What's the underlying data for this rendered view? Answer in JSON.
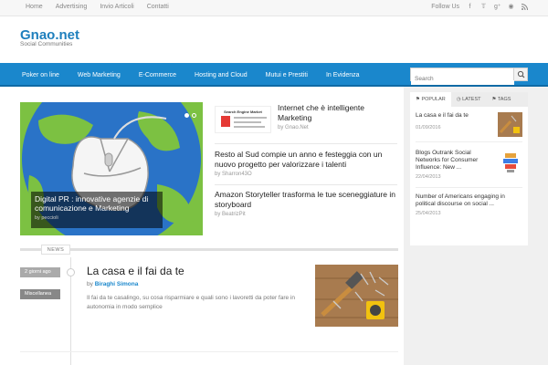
{
  "topbar": {
    "nav": [
      "Home",
      "Advertising",
      "Invio Articoli",
      "Contatti"
    ],
    "follow_label": "Follow Us",
    "social_icons": [
      "facebook-icon",
      "twitter-icon",
      "google-plus-icon",
      "pinterest-icon",
      "rss-icon"
    ]
  },
  "header": {
    "logo": "Gnao.net",
    "tagline": "Social Communities"
  },
  "mainnav": {
    "items": [
      "Poker on line",
      "Web Marketing",
      "E-Commerce",
      "Hosting and Cloud",
      "Mutui e Prestiti",
      "In Evidenza"
    ],
    "search_placeholder": "Search"
  },
  "hero": {
    "title": "Digital PR : innovative agenzie di comunicazione e Marketing",
    "author": "by peccioli"
  },
  "side_articles": [
    {
      "title": "Internet che è intelligente Marketing",
      "author": "by Gnao.Net",
      "thumb_text": "Search Engine Market"
    },
    {
      "title": "Resto al Sud compie un anno e festeggia con un nuovo progetto per valorizzare i talenti",
      "author": "by Sharron43O"
    },
    {
      "title": "Amazon Storyteller trasforma le tue sceneggiature in storyboard",
      "author": "by BeatrizPit"
    }
  ],
  "news": {
    "label": "NEWS",
    "date_tag": "2 giorni ago",
    "category_tag": "Miscellanea",
    "post_title": "La casa e il fai da te",
    "post_by_prefix": "by",
    "post_author": "Biraghi Simona",
    "post_excerpt": "Il fai da te casalingo, su cosa risparmiare e quali sono i lavoretti da poter fare in autonomia in modo semplice"
  },
  "widget": {
    "tabs": [
      "POPULAR",
      "LATEST",
      "TAGS"
    ],
    "items": [
      {
        "title": "La casa e il fai da te",
        "date": "01/09/2016"
      },
      {
        "title": "Blogs Outrank Social Networks for Consumer Influence: New ...",
        "date": "22/04/2013"
      },
      {
        "title": "Number of Americans engaging in political discourse on social ...",
        "date": "25/04/2013"
      }
    ]
  },
  "colors": {
    "brand": "#1a87cc",
    "nav_bg": "#1a87cc"
  }
}
